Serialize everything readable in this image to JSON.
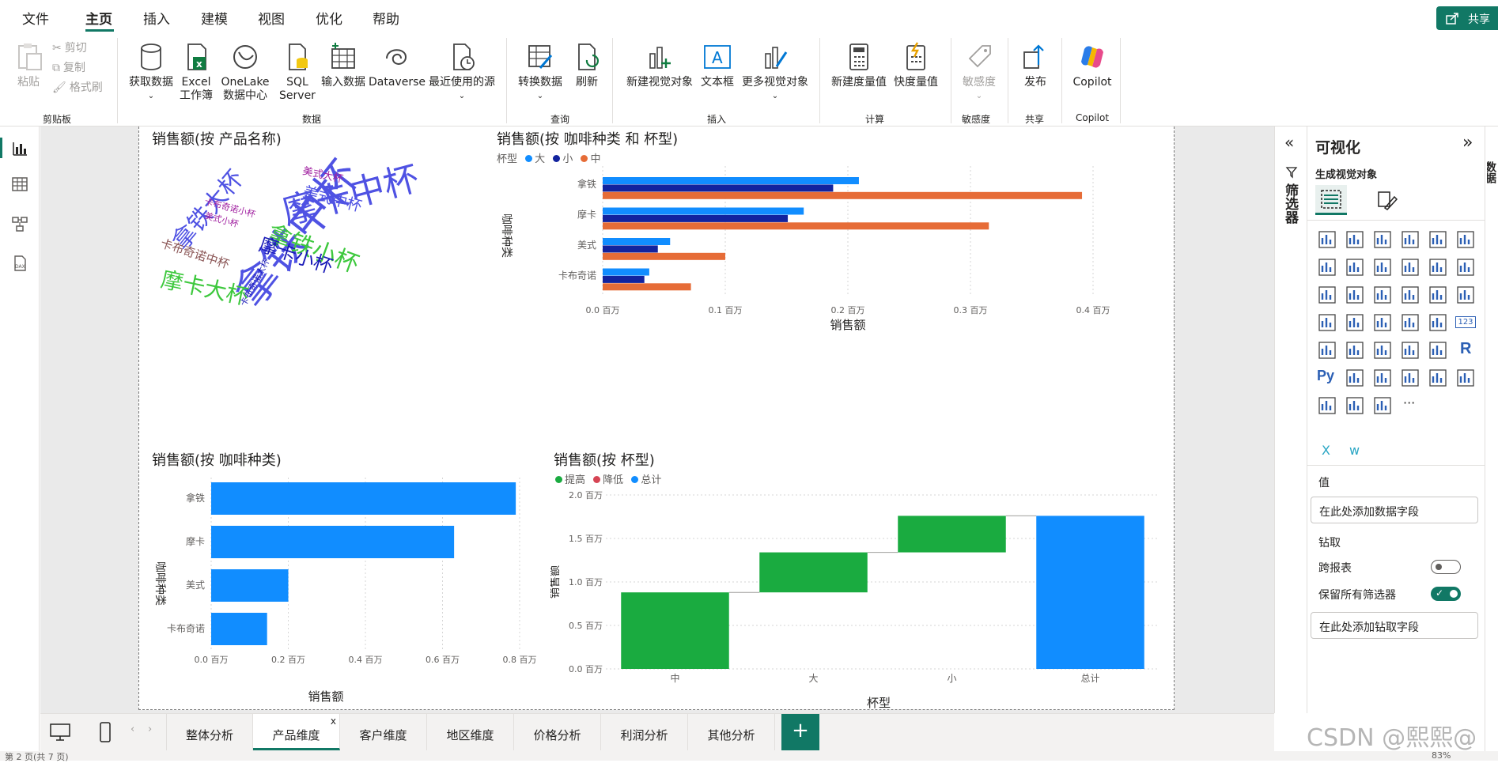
{
  "menu": {
    "items": [
      "文件",
      "主页",
      "插入",
      "建模",
      "视图",
      "优化",
      "帮助"
    ],
    "active": "主页",
    "share_label": "共享"
  },
  "ribbon": {
    "clipboard": {
      "paste": "粘贴",
      "cut": "剪切",
      "copy": "复制",
      "format_painter": "格式刷",
      "group": "剪贴板"
    },
    "data": {
      "get_data": "获取数据",
      "excel_1": "Excel",
      "excel_2": "工作簿",
      "onelake_1": "OneLake",
      "onelake_2": "数据中心",
      "sql_1": "SQL",
      "sql_2": "Server",
      "enter_data": "输入数据",
      "dataverse": "Dataverse",
      "recent": "最近使用的源",
      "group": "数据"
    },
    "query": {
      "transform": "转换数据",
      "refresh": "刷新",
      "group": "查询"
    },
    "insert": {
      "new_visual": "新建视觉对象",
      "textbox": "文本框",
      "more_visuals": "更多视觉对象",
      "group": "插入"
    },
    "calc": {
      "new_measure": "新建度量值",
      "quick_measure": "快度量值",
      "group": "计算"
    },
    "sensitivity": {
      "label": "敏感度",
      "group": "敏感度"
    },
    "share": {
      "publish": "发布",
      "group": "共享"
    },
    "copilot": {
      "label": "Copilot",
      "group": "Copilot"
    }
  },
  "visuals": {
    "wordcloud": {
      "title": "销售额(按 产品名称)",
      "words": [
        {
          "text": "拿铁中杯",
          "color": "#4f52e3"
        },
        {
          "text": "摩卡中杯",
          "color": "#4f52e3"
        },
        {
          "text": "拿铁大杯",
          "color": "#4f52e3"
        },
        {
          "text": "拿铁小杯",
          "color": "#3dc83d"
        },
        {
          "text": "摩卡大杯",
          "color": "#3dc83d"
        },
        {
          "text": "摩卡小杯",
          "color": "#1a1ab8"
        },
        {
          "text": "美式中杯",
          "color": "#4f52e3"
        },
        {
          "text": "美式大杯",
          "color": "#a020a0"
        },
        {
          "text": "美式小杯",
          "color": "#a020a0"
        },
        {
          "text": "卡布奇诺中杯",
          "color": "#8a5555"
        },
        {
          "text": "卡布奇诺小杯",
          "color": "#a020a0"
        },
        {
          "text": "卡布奇诺大杯",
          "color": "#1a1ab8"
        }
      ]
    },
    "clustered_bar": {
      "title": "销售额(按 咖啡种类 和 杯型)",
      "legend_title": "杯型"
    },
    "bar": {
      "title": "销售额(按 咖啡种类)"
    },
    "waterfall": {
      "title": "销售额(按 杯型)"
    }
  },
  "chart_data": [
    {
      "type": "bar",
      "orientation": "horizontal",
      "title": "销售额(按 咖啡种类 和 杯型)",
      "categories": [
        "拿铁",
        "摩卡",
        "美式",
        "卡布奇诺"
      ],
      "series": [
        {
          "name": "大",
          "color": "#118dff",
          "values": [
            0.209,
            0.164,
            0.055,
            0.038
          ]
        },
        {
          "name": "小",
          "color": "#12239e",
          "values": [
            0.188,
            0.151,
            0.045,
            0.034
          ]
        },
        {
          "name": "中",
          "color": "#e66c37",
          "values": [
            0.391,
            0.315,
            0.1,
            0.072
          ]
        }
      ],
      "xlabel": "销售额",
      "ylabel": "咖啡种类",
      "xlim": [
        0,
        0.4
      ],
      "xticks": [
        "0.0 百万",
        "0.1 百万",
        "0.2 百万",
        "0.3 百万",
        "0.4 百万"
      ],
      "legend": "top-left"
    },
    {
      "type": "bar",
      "orientation": "horizontal",
      "title": "销售额(按 咖啡种类)",
      "categories": [
        "拿铁",
        "摩卡",
        "美式",
        "卡布奇诺"
      ],
      "values": [
        0.79,
        0.63,
        0.2,
        0.145
      ],
      "color": "#118dff",
      "xlabel": "销售额",
      "ylabel": "咖啡种类",
      "xlim": [
        0,
        0.8
      ],
      "xticks": [
        "0.0 百万",
        "0.2 百万",
        "0.4 百万",
        "0.6 百万",
        "0.8 百万"
      ]
    },
    {
      "type": "waterfall",
      "title": "销售额(按 杯型)",
      "categories": [
        "中",
        "大",
        "小",
        "总计"
      ],
      "steps": [
        {
          "start": 0.0,
          "end": 0.88,
          "kind": "提高"
        },
        {
          "start": 0.88,
          "end": 1.34,
          "kind": "提高"
        },
        {
          "start": 1.34,
          "end": 1.76,
          "kind": "提高"
        },
        {
          "start": 0.0,
          "end": 1.76,
          "kind": "总计"
        }
      ],
      "legend": [
        {
          "name": "提高",
          "color": "#1aab40"
        },
        {
          "name": "降低",
          "color": "#d64554"
        },
        {
          "name": "总计",
          "color": "#118dff"
        }
      ],
      "xlabel": "杯型",
      "ylabel": "销售额",
      "ylim": [
        0,
        2.0
      ],
      "yticks": [
        "0.0 百万",
        "0.5 百万",
        "1.0 百万",
        "1.5 百万",
        "2.0 百万"
      ]
    }
  ],
  "tabs": {
    "items": [
      "整体分析",
      "产品维度",
      "客户维度",
      "地区维度",
      "价格分析",
      "利润分析",
      "其他分析"
    ],
    "active": "产品维度",
    "add": "+"
  },
  "filter_pane": {
    "label": "筛选器"
  },
  "viz_pane": {
    "title": "可视化",
    "build_label": "生成视觉对象",
    "values_label": "值",
    "values_placeholder": "在此处添加数据字段",
    "drill_label": "钻取",
    "cross_report": "跨报表",
    "keep_filters": "保留所有筛选器",
    "drill_placeholder": "在此处添加钻取字段",
    "py_label": "Py",
    "r_label": "R",
    "more": "···",
    "kpi_label": "123",
    "w_label": "w"
  },
  "data_pane": {
    "label": "数据"
  },
  "status": {
    "left": "第 2 页(共 7 页)",
    "zoom": "83%"
  },
  "watermark": "CSDN @熙熙@"
}
